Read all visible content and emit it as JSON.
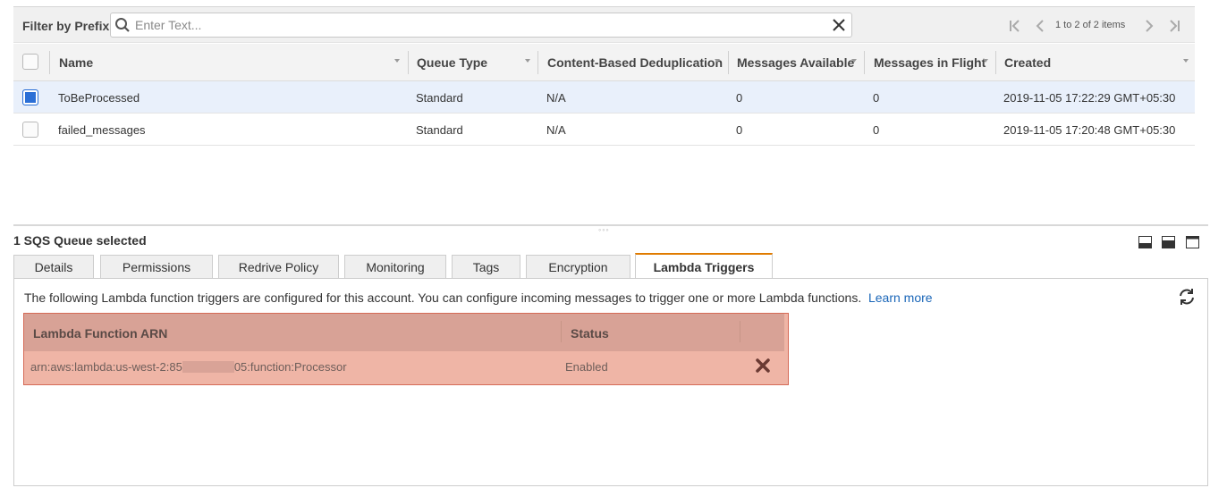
{
  "filter": {
    "label": "Filter by Prefix:",
    "placeholder": "Enter Text...",
    "value": ""
  },
  "pager": {
    "text": "1 to 2 of 2 items"
  },
  "table": {
    "columns": [
      "Name",
      "Queue Type",
      "Content-Based Deduplication",
      "Messages Available",
      "Messages in Flight",
      "Created"
    ],
    "rows": [
      {
        "selected": true,
        "name": "ToBeProcessed",
        "type": "Standard",
        "dedup": "N/A",
        "available": "0",
        "inflight": "0",
        "created": "2019-11-05 17:22:29 GMT+05:30"
      },
      {
        "selected": false,
        "name": "failed_messages",
        "type": "Standard",
        "dedup": "N/A",
        "available": "0",
        "inflight": "0",
        "created": "2019-11-05 17:20:48 GMT+05:30"
      }
    ]
  },
  "details": {
    "title": "1 SQS Queue selected",
    "tabs": [
      "Details",
      "Permissions",
      "Redrive Policy",
      "Monitoring",
      "Tags",
      "Encryption",
      "Lambda Triggers"
    ],
    "active_tab": "Lambda Triggers",
    "description": "The following Lambda function triggers are configured for this account. You can configure incoming messages to trigger one or more Lambda functions.",
    "learn_more": "Learn more",
    "lambda_table": {
      "columns": [
        "Lambda Function ARN",
        "Status"
      ],
      "rows": [
        {
          "arn_prefix": "arn:aws:lambda:us-west-2:85",
          "arn_suffix": "05:function:Processor",
          "status": "Enabled"
        }
      ]
    }
  },
  "colors": {
    "accent_tab": "#e07b00",
    "selected_row": "#e9f0fb",
    "checkbox_on": "#2b6fd6",
    "highlight_table": "#efb5a6",
    "link": "#1a66b8"
  },
  "icons": [
    "search-icon",
    "clear-icon",
    "first-page-icon",
    "prev-page-icon",
    "next-page-icon",
    "last-page-icon",
    "refresh-icon",
    "delete-icon",
    "layout-icons"
  ]
}
